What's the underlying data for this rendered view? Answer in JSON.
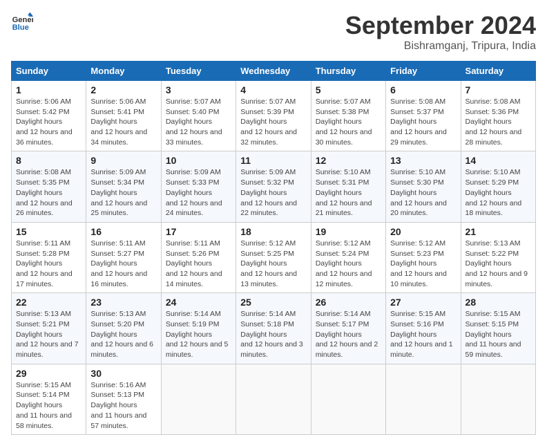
{
  "logo": {
    "line1": "General",
    "line2": "Blue"
  },
  "title": "September 2024",
  "location": "Bishramganj, Tripura, India",
  "weekdays": [
    "Sunday",
    "Monday",
    "Tuesday",
    "Wednesday",
    "Thursday",
    "Friday",
    "Saturday"
  ],
  "days": [
    {
      "day": "",
      "info": ""
    },
    {
      "day": "",
      "info": ""
    },
    {
      "day": "",
      "info": ""
    },
    {
      "day": "",
      "info": ""
    },
    {
      "day": "",
      "info": ""
    },
    {
      "day": "",
      "info": ""
    },
    {
      "day": "1",
      "sunrise": "5:06 AM",
      "sunset": "5:42 PM",
      "daylight": "12 hours and 36 minutes."
    },
    {
      "day": "2",
      "sunrise": "5:06 AM",
      "sunset": "5:41 PM",
      "daylight": "12 hours and 34 minutes."
    },
    {
      "day": "3",
      "sunrise": "5:07 AM",
      "sunset": "5:40 PM",
      "daylight": "12 hours and 33 minutes."
    },
    {
      "day": "4",
      "sunrise": "5:07 AM",
      "sunset": "5:39 PM",
      "daylight": "12 hours and 32 minutes."
    },
    {
      "day": "5",
      "sunrise": "5:07 AM",
      "sunset": "5:38 PM",
      "daylight": "12 hours and 30 minutes."
    },
    {
      "day": "6",
      "sunrise": "5:08 AM",
      "sunset": "5:37 PM",
      "daylight": "12 hours and 29 minutes."
    },
    {
      "day": "7",
      "sunrise": "5:08 AM",
      "sunset": "5:36 PM",
      "daylight": "12 hours and 28 minutes."
    },
    {
      "day": "8",
      "sunrise": "5:08 AM",
      "sunset": "5:35 PM",
      "daylight": "12 hours and 26 minutes."
    },
    {
      "day": "9",
      "sunrise": "5:09 AM",
      "sunset": "5:34 PM",
      "daylight": "12 hours and 25 minutes."
    },
    {
      "day": "10",
      "sunrise": "5:09 AM",
      "sunset": "5:33 PM",
      "daylight": "12 hours and 24 minutes."
    },
    {
      "day": "11",
      "sunrise": "5:09 AM",
      "sunset": "5:32 PM",
      "daylight": "12 hours and 22 minutes."
    },
    {
      "day": "12",
      "sunrise": "5:10 AM",
      "sunset": "5:31 PM",
      "daylight": "12 hours and 21 minutes."
    },
    {
      "day": "13",
      "sunrise": "5:10 AM",
      "sunset": "5:30 PM",
      "daylight": "12 hours and 20 minutes."
    },
    {
      "day": "14",
      "sunrise": "5:10 AM",
      "sunset": "5:29 PM",
      "daylight": "12 hours and 18 minutes."
    },
    {
      "day": "15",
      "sunrise": "5:11 AM",
      "sunset": "5:28 PM",
      "daylight": "12 hours and 17 minutes."
    },
    {
      "day": "16",
      "sunrise": "5:11 AM",
      "sunset": "5:27 PM",
      "daylight": "12 hours and 16 minutes."
    },
    {
      "day": "17",
      "sunrise": "5:11 AM",
      "sunset": "5:26 PM",
      "daylight": "12 hours and 14 minutes."
    },
    {
      "day": "18",
      "sunrise": "5:12 AM",
      "sunset": "5:25 PM",
      "daylight": "12 hours and 13 minutes."
    },
    {
      "day": "19",
      "sunrise": "5:12 AM",
      "sunset": "5:24 PM",
      "daylight": "12 hours and 12 minutes."
    },
    {
      "day": "20",
      "sunrise": "5:12 AM",
      "sunset": "5:23 PM",
      "daylight": "12 hours and 10 minutes."
    },
    {
      "day": "21",
      "sunrise": "5:13 AM",
      "sunset": "5:22 PM",
      "daylight": "12 hours and 9 minutes."
    },
    {
      "day": "22",
      "sunrise": "5:13 AM",
      "sunset": "5:21 PM",
      "daylight": "12 hours and 7 minutes."
    },
    {
      "day": "23",
      "sunrise": "5:13 AM",
      "sunset": "5:20 PM",
      "daylight": "12 hours and 6 minutes."
    },
    {
      "day": "24",
      "sunrise": "5:14 AM",
      "sunset": "5:19 PM",
      "daylight": "12 hours and 5 minutes."
    },
    {
      "day": "25",
      "sunrise": "5:14 AM",
      "sunset": "5:18 PM",
      "daylight": "12 hours and 3 minutes."
    },
    {
      "day": "26",
      "sunrise": "5:14 AM",
      "sunset": "5:17 PM",
      "daylight": "12 hours and 2 minutes."
    },
    {
      "day": "27",
      "sunrise": "5:15 AM",
      "sunset": "5:16 PM",
      "daylight": "12 hours and 1 minute."
    },
    {
      "day": "28",
      "sunrise": "5:15 AM",
      "sunset": "5:15 PM",
      "daylight": "11 hours and 59 minutes."
    },
    {
      "day": "29",
      "sunrise": "5:15 AM",
      "sunset": "5:14 PM",
      "daylight": "11 hours and 58 minutes."
    },
    {
      "day": "30",
      "sunrise": "5:16 AM",
      "sunset": "5:13 PM",
      "daylight": "11 hours and 57 minutes."
    },
    {
      "day": "",
      "info": ""
    },
    {
      "day": "",
      "info": ""
    },
    {
      "day": "",
      "info": ""
    },
    {
      "day": "",
      "info": ""
    },
    {
      "day": "",
      "info": ""
    }
  ]
}
